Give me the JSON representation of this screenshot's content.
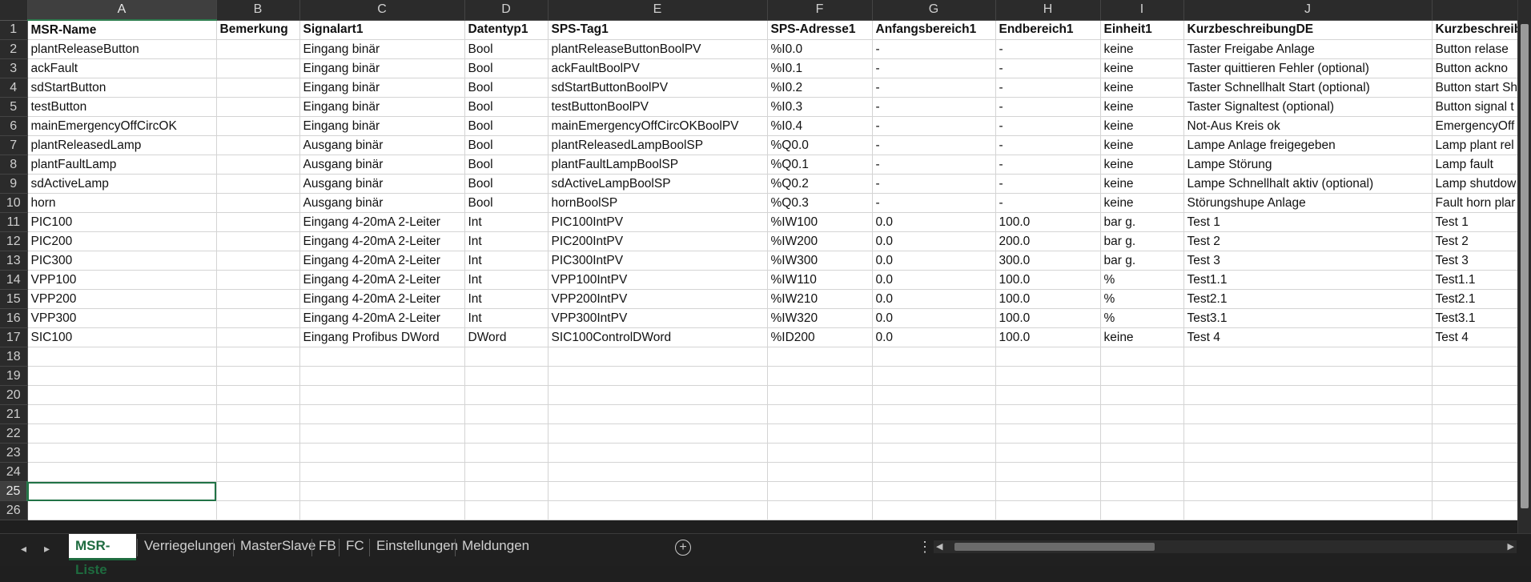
{
  "columns": [
    "A",
    "B",
    "C",
    "D",
    "E",
    "F",
    "G",
    "H",
    "I",
    "J",
    ""
  ],
  "rows": [
    {
      "num": "1",
      "cells": [
        "MSR-Name",
        "Bemerkung",
        "Signalart1",
        "Datentyp1",
        "SPS-Tag1",
        "SPS-Adresse1",
        "Anfangsbereich1",
        "Endbereich1",
        "Einheit1",
        "KurzbeschreibungDE",
        "Kurzbeschreib"
      ]
    },
    {
      "num": "2",
      "cells": [
        "plantReleaseButton",
        "",
        "Eingang binär",
        "Bool",
        "plantReleaseButtonBoolPV",
        "%I0.0",
        "-",
        "-",
        "keine",
        "Taster Freigabe Anlage",
        "Button relase"
      ]
    },
    {
      "num": "3",
      "cells": [
        "ackFault",
        "",
        "Eingang binär",
        "Bool",
        "ackFaultBoolPV",
        "%I0.1",
        "-",
        "-",
        "keine",
        "Taster quittieren Fehler (optional)",
        "Button ackno"
      ]
    },
    {
      "num": "4",
      "cells": [
        "sdStartButton",
        "",
        "Eingang binär",
        "Bool",
        "sdStartButtonBoolPV",
        "%I0.2",
        "-",
        "-",
        "keine",
        "Taster Schnellhalt Start (optional)",
        "Button start Sh"
      ]
    },
    {
      "num": "5",
      "cells": [
        "testButton",
        "",
        "Eingang binär",
        "Bool",
        "testButtonBoolPV",
        "%I0.3",
        "-",
        "-",
        "keine",
        "Taster Signaltest (optional)",
        "Button signal t"
      ]
    },
    {
      "num": "6",
      "cells": [
        "mainEmergencyOffCircOK",
        "",
        "Eingang binär",
        "Bool",
        "mainEmergencyOffCircOKBoolPV",
        "%I0.4",
        "-",
        "-",
        "keine",
        "Not-Aus Kreis ok",
        "EmergencyOff"
      ]
    },
    {
      "num": "7",
      "cells": [
        "plantReleasedLamp",
        "",
        "Ausgang binär",
        "Bool",
        "plantReleasedLampBoolSP",
        "%Q0.0",
        "-",
        "-",
        "keine",
        "Lampe Anlage freigegeben",
        "Lamp plant rel"
      ]
    },
    {
      "num": "8",
      "cells": [
        "plantFaultLamp",
        "",
        "Ausgang binär",
        "Bool",
        "plantFaultLampBoolSP",
        "%Q0.1",
        "-",
        "-",
        "keine",
        "Lampe Störung",
        "Lamp fault"
      ]
    },
    {
      "num": "9",
      "cells": [
        "sdActiveLamp",
        "",
        "Ausgang binär",
        "Bool",
        "sdActiveLampBoolSP",
        "%Q0.2",
        "-",
        "-",
        "keine",
        "Lampe Schnellhalt aktiv (optional)",
        "Lamp shutdow"
      ]
    },
    {
      "num": "10",
      "cells": [
        "horn",
        "",
        "Ausgang binär",
        "Bool",
        "hornBoolSP",
        "%Q0.3",
        "-",
        "-",
        "keine",
        "Störungshupe Anlage",
        "Fault horn plar"
      ]
    },
    {
      "num": "11",
      "cells": [
        "PIC100",
        "",
        "Eingang 4-20mA 2-Leiter",
        "Int",
        "PIC100IntPV",
        "%IW100",
        "0.0",
        "100.0",
        "bar g.",
        "Test 1",
        "Test 1"
      ]
    },
    {
      "num": "12",
      "cells": [
        "PIC200",
        "",
        "Eingang 4-20mA 2-Leiter",
        "Int",
        "PIC200IntPV",
        "%IW200",
        "0.0",
        "200.0",
        "bar g.",
        "Test 2",
        "Test 2"
      ]
    },
    {
      "num": "13",
      "cells": [
        "PIC300",
        "",
        "Eingang 4-20mA 2-Leiter",
        "Int",
        "PIC300IntPV",
        "%IW300",
        "0.0",
        "300.0",
        "bar g.",
        "Test 3",
        "Test 3"
      ]
    },
    {
      "num": "14",
      "cells": [
        "VPP100",
        "",
        "Eingang 4-20mA 2-Leiter",
        "Int",
        "VPP100IntPV",
        "%IW110",
        "0.0",
        "100.0",
        "%",
        "Test1.1",
        "Test1.1"
      ]
    },
    {
      "num": "15",
      "cells": [
        "VPP200",
        "",
        "Eingang 4-20mA 2-Leiter",
        "Int",
        "VPP200IntPV",
        "%IW210",
        "0.0",
        "100.0",
        "%",
        "Test2.1",
        "Test2.1"
      ]
    },
    {
      "num": "16",
      "cells": [
        "VPP300",
        "",
        "Eingang 4-20mA 2-Leiter",
        "Int",
        "VPP300IntPV",
        "%IW320",
        "0.0",
        "100.0",
        "%",
        "Test3.1",
        "Test3.1"
      ]
    },
    {
      "num": "17",
      "cells": [
        "SIC100",
        "",
        "Eingang Profibus DWord",
        "DWord",
        "SIC100ControlDWord",
        "%ID200",
        "0.0",
        "100.0",
        "keine",
        "Test 4",
        "Test 4"
      ]
    },
    {
      "num": "18",
      "cells": [
        "",
        "",
        "",
        "",
        "",
        "",
        "",
        "",
        "",
        "",
        ""
      ]
    },
    {
      "num": "19",
      "cells": [
        "",
        "",
        "",
        "",
        "",
        "",
        "",
        "",
        "",
        "",
        ""
      ]
    },
    {
      "num": "20",
      "cells": [
        "",
        "",
        "",
        "",
        "",
        "",
        "",
        "",
        "",
        "",
        ""
      ]
    },
    {
      "num": "21",
      "cells": [
        "",
        "",
        "",
        "",
        "",
        "",
        "",
        "",
        "",
        "",
        ""
      ]
    },
    {
      "num": "22",
      "cells": [
        "",
        "",
        "",
        "",
        "",
        "",
        "",
        "",
        "",
        "",
        ""
      ]
    },
    {
      "num": "23",
      "cells": [
        "",
        "",
        "",
        "",
        "",
        "",
        "",
        "",
        "",
        "",
        ""
      ]
    },
    {
      "num": "24",
      "cells": [
        "",
        "",
        "",
        "",
        "",
        "",
        "",
        "",
        "",
        "",
        ""
      ]
    },
    {
      "num": "25",
      "cells": [
        "",
        "",
        "",
        "",
        "",
        "",
        "",
        "",
        "",
        "",
        ""
      ]
    },
    {
      "num": "26",
      "cells": [
        "",
        "",
        "",
        "",
        "",
        "",
        "",
        "",
        "",
        "",
        ""
      ]
    }
  ],
  "selection": {
    "column": "A",
    "row": "25"
  },
  "sheets": [
    "MSR-Liste",
    "Verriegelungen",
    "MasterSlave",
    "FB",
    "FC",
    "Einstellungen",
    "Meldungen"
  ],
  "active_sheet": "MSR-Liste",
  "icons": {
    "prev": "chevron-left-icon",
    "next": "chevron-right-icon",
    "add": "plus-circle-icon",
    "more": "vertical-ellipsis-icon"
  },
  "colors": {
    "accent": "#217346",
    "header_bg": "#2b2b2b",
    "grid_line": "#d4d4d4"
  }
}
